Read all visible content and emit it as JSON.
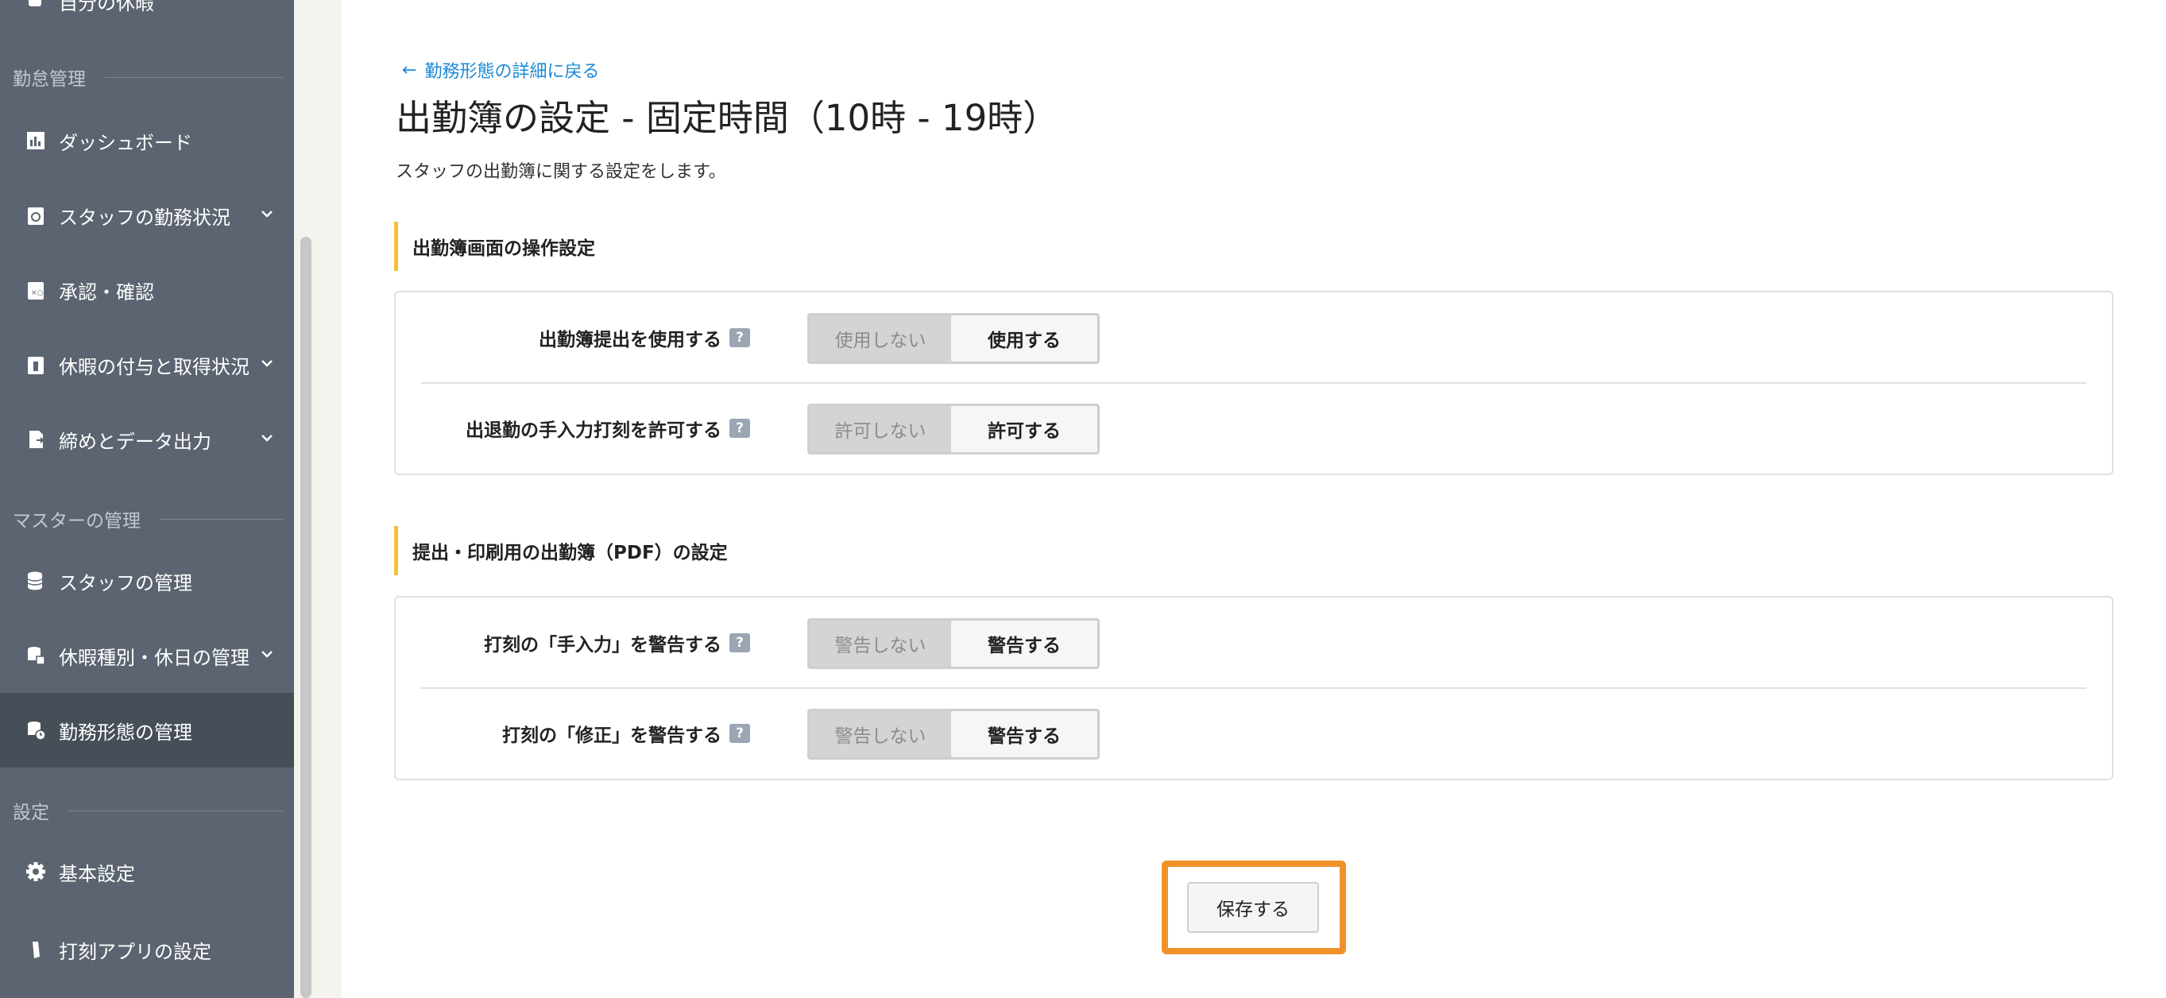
{
  "sidebar": {
    "top_partial_label": "自分の休暇",
    "sections": {
      "attendance": "勤怠管理",
      "master": "マスターの管理",
      "settings": "設定"
    },
    "items": [
      {
        "label": "ダッシュボード",
        "icon": "chart-icon"
      },
      {
        "label": "スタッフの勤務状況",
        "icon": "clock-clipboard-icon"
      },
      {
        "label": "承認・確認",
        "icon": "check-clipboard-icon"
      },
      {
        "label": "休暇の付与と取得状況",
        "icon": "leave-clipboard-icon"
      },
      {
        "label": "締めとデータ出力",
        "icon": "export-document-icon"
      },
      {
        "label": "スタッフの管理",
        "icon": "database-icon"
      },
      {
        "label": "休暇種別・休日の管理",
        "icon": "database-calendar-icon"
      },
      {
        "label": "勤務形態の管理",
        "icon": "database-clock-icon"
      },
      {
        "label": "基本設定",
        "icon": "gear-icon"
      },
      {
        "label": "打刻アプリの設定",
        "icon": "phone-icon"
      }
    ]
  },
  "main": {
    "back_link": "勤務形態の詳細に戻る",
    "title": "出勤簿の設定 - 固定時間（10時 - 19時）",
    "description": "スタッフの出勤簿に関する設定をします。",
    "sections": [
      {
        "heading": "出勤簿画面の操作設定",
        "rows": [
          {
            "label": "出勤簿提出を使用する",
            "off": "使用しない",
            "on": "使用する"
          },
          {
            "label": "出退勤の手入力打刻を許可する",
            "off": "許可しない",
            "on": "許可する"
          }
        ]
      },
      {
        "heading": "提出・印刷用の出勤簿（PDF）の設定",
        "rows": [
          {
            "label": "打刻の「手入力」を警告する",
            "off": "警告しない",
            "on": "警告する"
          },
          {
            "label": "打刻の「修正」を警告する",
            "off": "警告しない",
            "on": "警告する"
          }
        ]
      }
    ],
    "help_glyph": "?",
    "save_label": "保存する"
  },
  "colors": {
    "sidebar_bg": "#5b6470",
    "sidebar_active": "#464e58",
    "link": "#1a8ad8",
    "section_accent": "#f2c03a",
    "highlight": "#f0922a"
  }
}
